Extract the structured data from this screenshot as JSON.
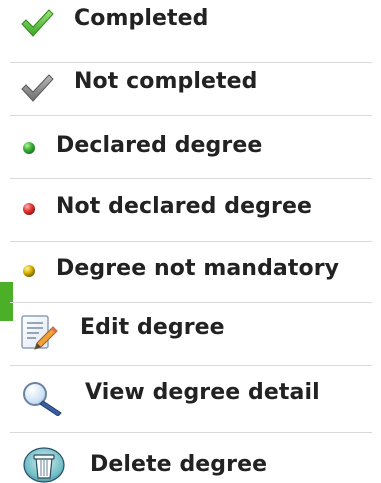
{
  "legend": {
    "items": [
      {
        "icon": "checkmark-green-icon",
        "label": "Completed"
      },
      {
        "icon": "checkmark-gray-icon",
        "label": "Not completed"
      },
      {
        "icon": "green-dot-icon",
        "label": "Declared degree"
      },
      {
        "icon": "red-dot-icon",
        "label": "Not declared degree"
      },
      {
        "icon": "yellow-dot-icon",
        "label": "Degree not mandatory"
      },
      {
        "icon": "edit-document-icon",
        "label": "Edit degree"
      },
      {
        "icon": "magnifier-icon",
        "label": "View degree detail"
      },
      {
        "icon": "trash-bin-icon",
        "label": "Delete degree"
      }
    ]
  },
  "colors": {
    "text": "#222222",
    "divider": "#d9d9d9",
    "accent_bar": "#4caf28",
    "completed_check": "#5cc43a",
    "not_completed_check": "#8a8a8a",
    "declared_dot": "#39b239",
    "not_declared_dot": "#e53935",
    "not_mandatory_dot": "#d9b400"
  }
}
